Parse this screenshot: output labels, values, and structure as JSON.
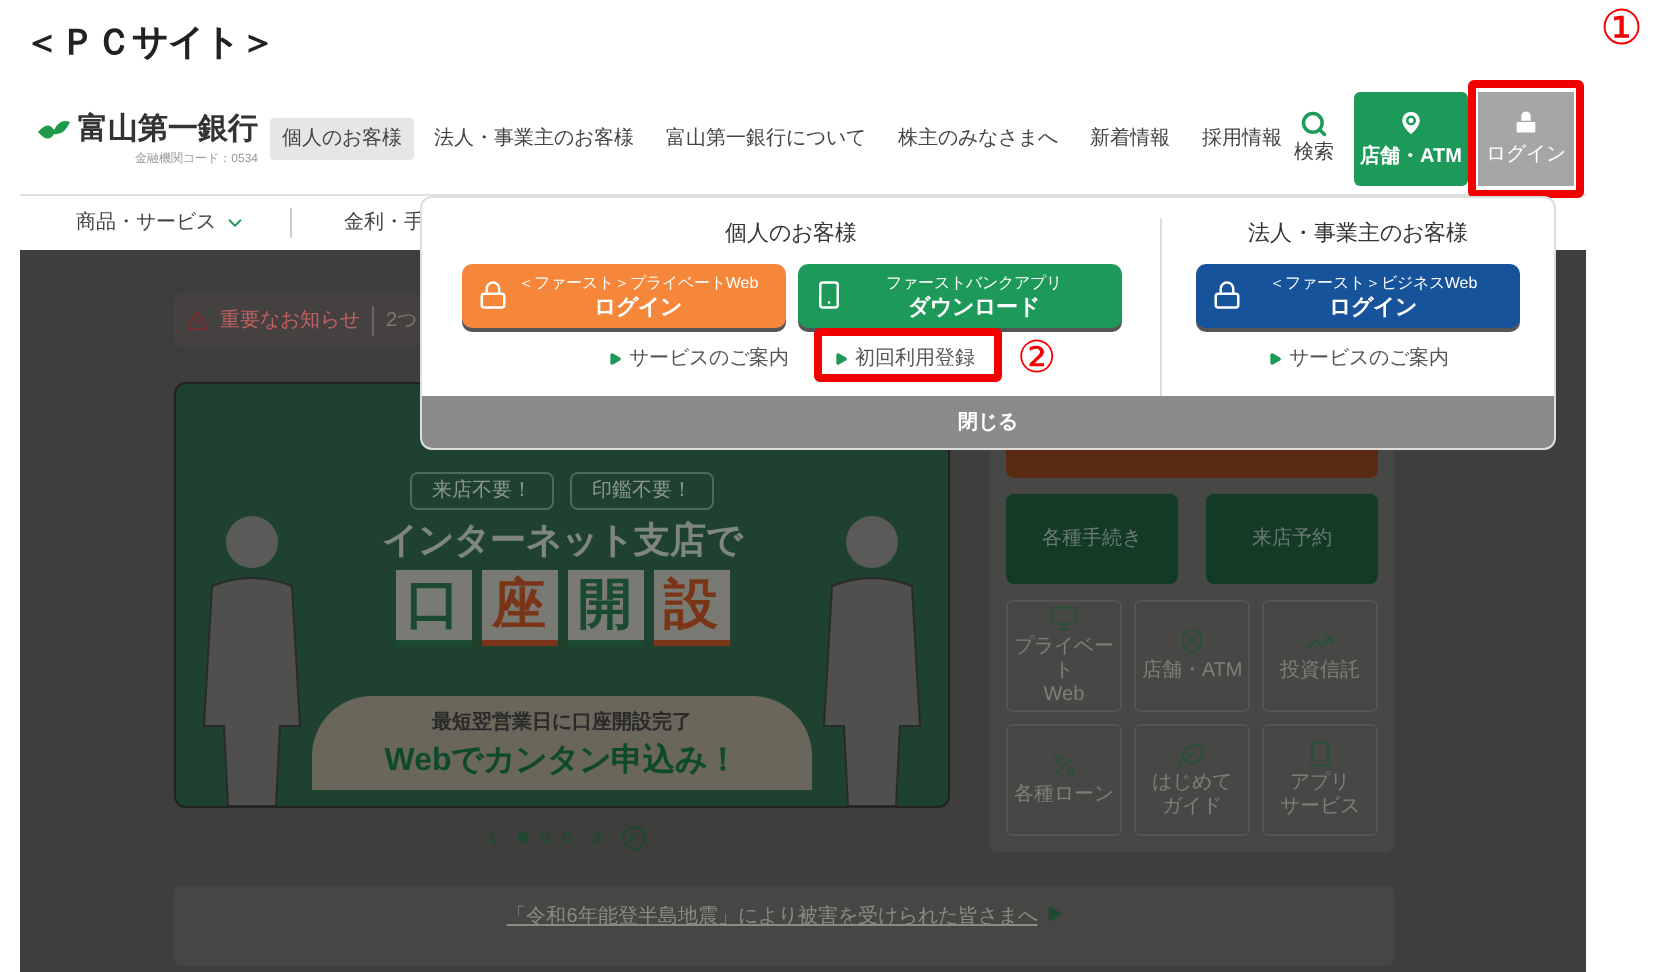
{
  "page_label": "＜ＰＣサイト＞",
  "header": {
    "logo": "富山第一銀行",
    "bank_code": "金融機関コード：0534",
    "nav": [
      {
        "label": "個人のお客様",
        "selected": true
      },
      {
        "label": "法人・事業主のお客様",
        "selected": false
      },
      {
        "label": "富山第一銀行について",
        "selected": false
      },
      {
        "label": "株主のみなさまへ",
        "selected": false
      },
      {
        "label": "新着情報",
        "selected": false
      },
      {
        "label": "採用情報",
        "selected": false
      }
    ],
    "search": "検索",
    "store_button": "店舗・ATM",
    "login_button": {
      "label": "ログイン",
      "highlighted": true
    }
  },
  "subnav": [
    {
      "label": "商品・サービス",
      "kind": "menu"
    },
    {
      "label": "金利・手",
      "kind": "link"
    }
  ],
  "notice": {
    "label": "重要なお知らせ",
    "text": "2つ"
  },
  "banner": {
    "badges": [
      "来店不要！",
      "印鑑不要！"
    ],
    "headline": "インターネット支店で",
    "tiles": [
      {
        "char": "口",
        "color": "#1a4a30"
      },
      {
        "char": "座",
        "color": "#7a3518"
      },
      {
        "char": "開",
        "color": "#1a4a30"
      },
      {
        "char": "設",
        "color": "#7a3518"
      }
    ],
    "subline": "最短翌営業日に口座開設完了",
    "cta": "Webでカンタン申込み！"
  },
  "carousel": {
    "dots": [
      {
        "selected": true
      },
      {
        "selected": false
      },
      {
        "selected": false
      }
    ]
  },
  "quick_menu": {
    "buttons": [
      "各種手続き",
      "来店予約"
    ],
    "tiles": [
      {
        "kind": "monitor",
        "lines": [
          "プライベート",
          "Web"
        ]
      },
      {
        "kind": "pin",
        "lines": [
          "店舗・ATM"
        ]
      },
      {
        "kind": "chart",
        "lines": [
          "投資信託"
        ]
      },
      {
        "kind": "percent",
        "lines": [
          "各種ローン"
        ]
      },
      {
        "kind": "leaf",
        "lines": [
          "はじめて",
          "ガイド"
        ]
      },
      {
        "kind": "phone",
        "lines": [
          "アプリ",
          "サービス"
        ]
      }
    ]
  },
  "disaster_notice": "「令和6年能登半島地震」により被害を受けられた皆さまへ",
  "login_menu": {
    "sections": [
      {
        "title": "個人のお客様",
        "buttons": [
          {
            "kind": "lock",
            "color": "#f5863a",
            "subtitle": "＜ファースト＞プライベートWeb",
            "label": "ログイン"
          },
          {
            "kind": "phone",
            "color": "#1d9a5a",
            "subtitle": "ファーストバンクアプリ",
            "label": "ダウンロード"
          }
        ],
        "links": [
          {
            "label": "サービスのご案内",
            "highlighted": false
          },
          {
            "label": "初回利用登録",
            "highlighted": true
          }
        ]
      },
      {
        "title": "法人・事業主のお客様",
        "buttons": [
          {
            "kind": "lock",
            "color": "#17539a",
            "subtitle": "＜ファースト＞ビジネスWeb",
            "label": "ログイン"
          }
        ],
        "links": [
          {
            "label": "サービスのご案内",
            "highlighted": false
          }
        ]
      }
    ],
    "close": "閉じる"
  },
  "annotations": [
    {
      "label": "①"
    },
    {
      "label": "②"
    }
  ]
}
